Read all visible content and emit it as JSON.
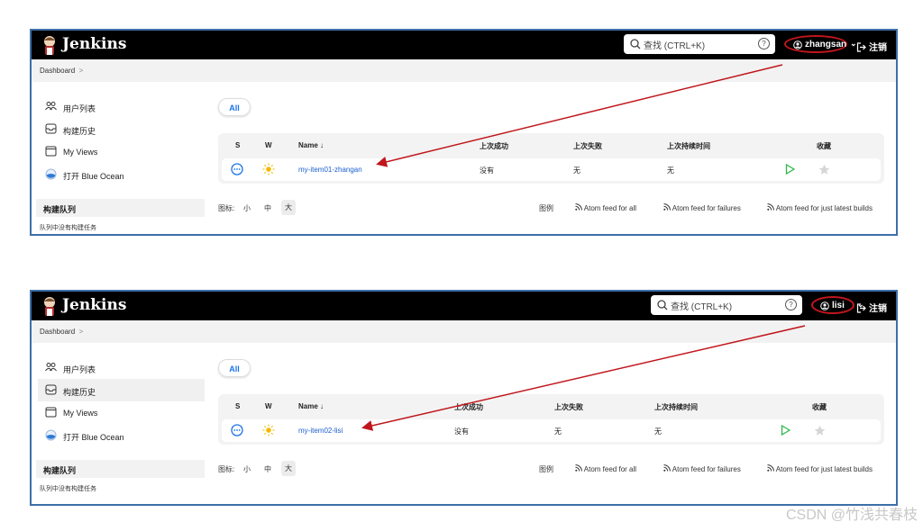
{
  "screens": [
    {
      "app_name": "Jenkins",
      "search_placeholder": "查找 (CTRL+K)",
      "help": "?",
      "username": "zhangsan",
      "logout": "注销",
      "breadcrumb": "Dashboard",
      "breadcrumb_sep": ">",
      "sidebar": [
        "用户列表",
        "构建历史",
        "My Views",
        "打开 Blue Ocean"
      ],
      "queue_title": "构建队列",
      "queue_empty": "队列中没有构建任务",
      "view_tab": "All",
      "columns": {
        "s": "S",
        "w": "W",
        "name": "Name ↓",
        "last_success": "上次成功",
        "last_failure": "上次失败",
        "last_duration": "上次持续时间",
        "fav": "收藏"
      },
      "job": {
        "name": "my-item01-zhangan",
        "last_success": "没有",
        "last_failure": "无",
        "last_duration": "无"
      },
      "icon_size_label": "图标:",
      "sizes": [
        "小",
        "中",
        "大"
      ],
      "legend": "图例",
      "feeds": [
        "Atom feed for all",
        "Atom feed for failures",
        "Atom feed for just latest builds"
      ]
    },
    {
      "app_name": "Jenkins",
      "search_placeholder": "查找 (CTRL+K)",
      "help": "?",
      "username": "lisi",
      "logout": "注销",
      "breadcrumb": "Dashboard",
      "breadcrumb_sep": ">",
      "sidebar": [
        "用户列表",
        "构建历史",
        "My Views",
        "打开 Blue Ocean"
      ],
      "queue_title": "构建队列",
      "queue_empty": "队列中没有构建任务",
      "view_tab": "All",
      "columns": {
        "s": "S",
        "w": "W",
        "name": "Name ↓",
        "last_success": "上次成功",
        "last_failure": "上次失败",
        "last_duration": "上次持续时间",
        "fav": "收藏"
      },
      "job": {
        "name": "my-item02-lisi",
        "last_success": "没有",
        "last_failure": "无",
        "last_duration": "无"
      },
      "icon_size_label": "图标:",
      "sizes": [
        "小",
        "中",
        "大"
      ],
      "legend": "图例",
      "feeds": [
        "Atom feed for all",
        "Atom feed for failures",
        "Atom feed for just latest builds"
      ]
    }
  ],
  "watermark": "CSDN @竹浅共春枝",
  "colors": {
    "header": "#000000",
    "frame": "#3d6fa8",
    "link": "#1a5fd0",
    "annotation": "#c0161c",
    "run": "#2db84a"
  }
}
